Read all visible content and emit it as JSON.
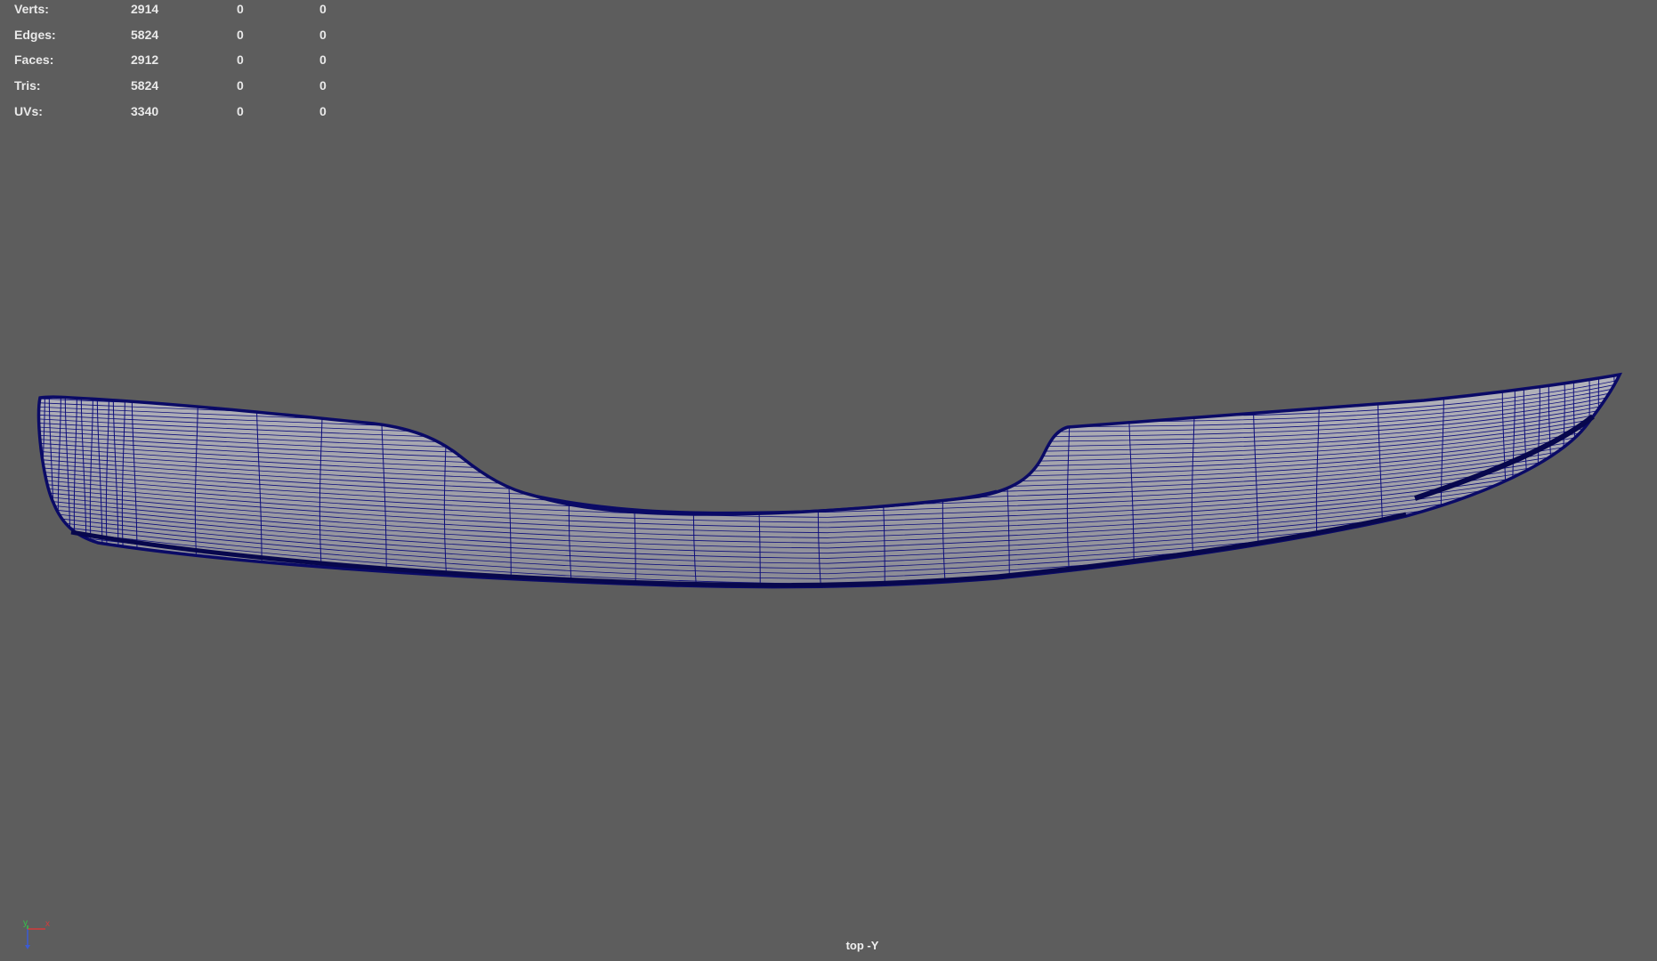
{
  "hud": {
    "rows": [
      {
        "label": "Verts:",
        "v1": "2914",
        "v2": "0",
        "v3": "0"
      },
      {
        "label": "Edges:",
        "v1": "5824",
        "v2": "0",
        "v3": "0"
      },
      {
        "label": "Faces:",
        "v1": "2912",
        "v2": "0",
        "v3": "0"
      },
      {
        "label": "Tris:",
        "v1": "5824",
        "v2": "0",
        "v3": "0"
      },
      {
        "label": "UVs:",
        "v1": "3340",
        "v2": "0",
        "v3": "0"
      }
    ]
  },
  "viewport": {
    "camera_label": "top -Y",
    "background_color": "#5d5d5d",
    "wireframe_color": "#0c0c7a",
    "surface_color": "#a3a3ab"
  },
  "axis_gizmo": {
    "x_label": "x",
    "y_label": "y",
    "x_color": "#d43b3b",
    "y_color": "#33c24a",
    "z_color": "#3b5bd4"
  }
}
